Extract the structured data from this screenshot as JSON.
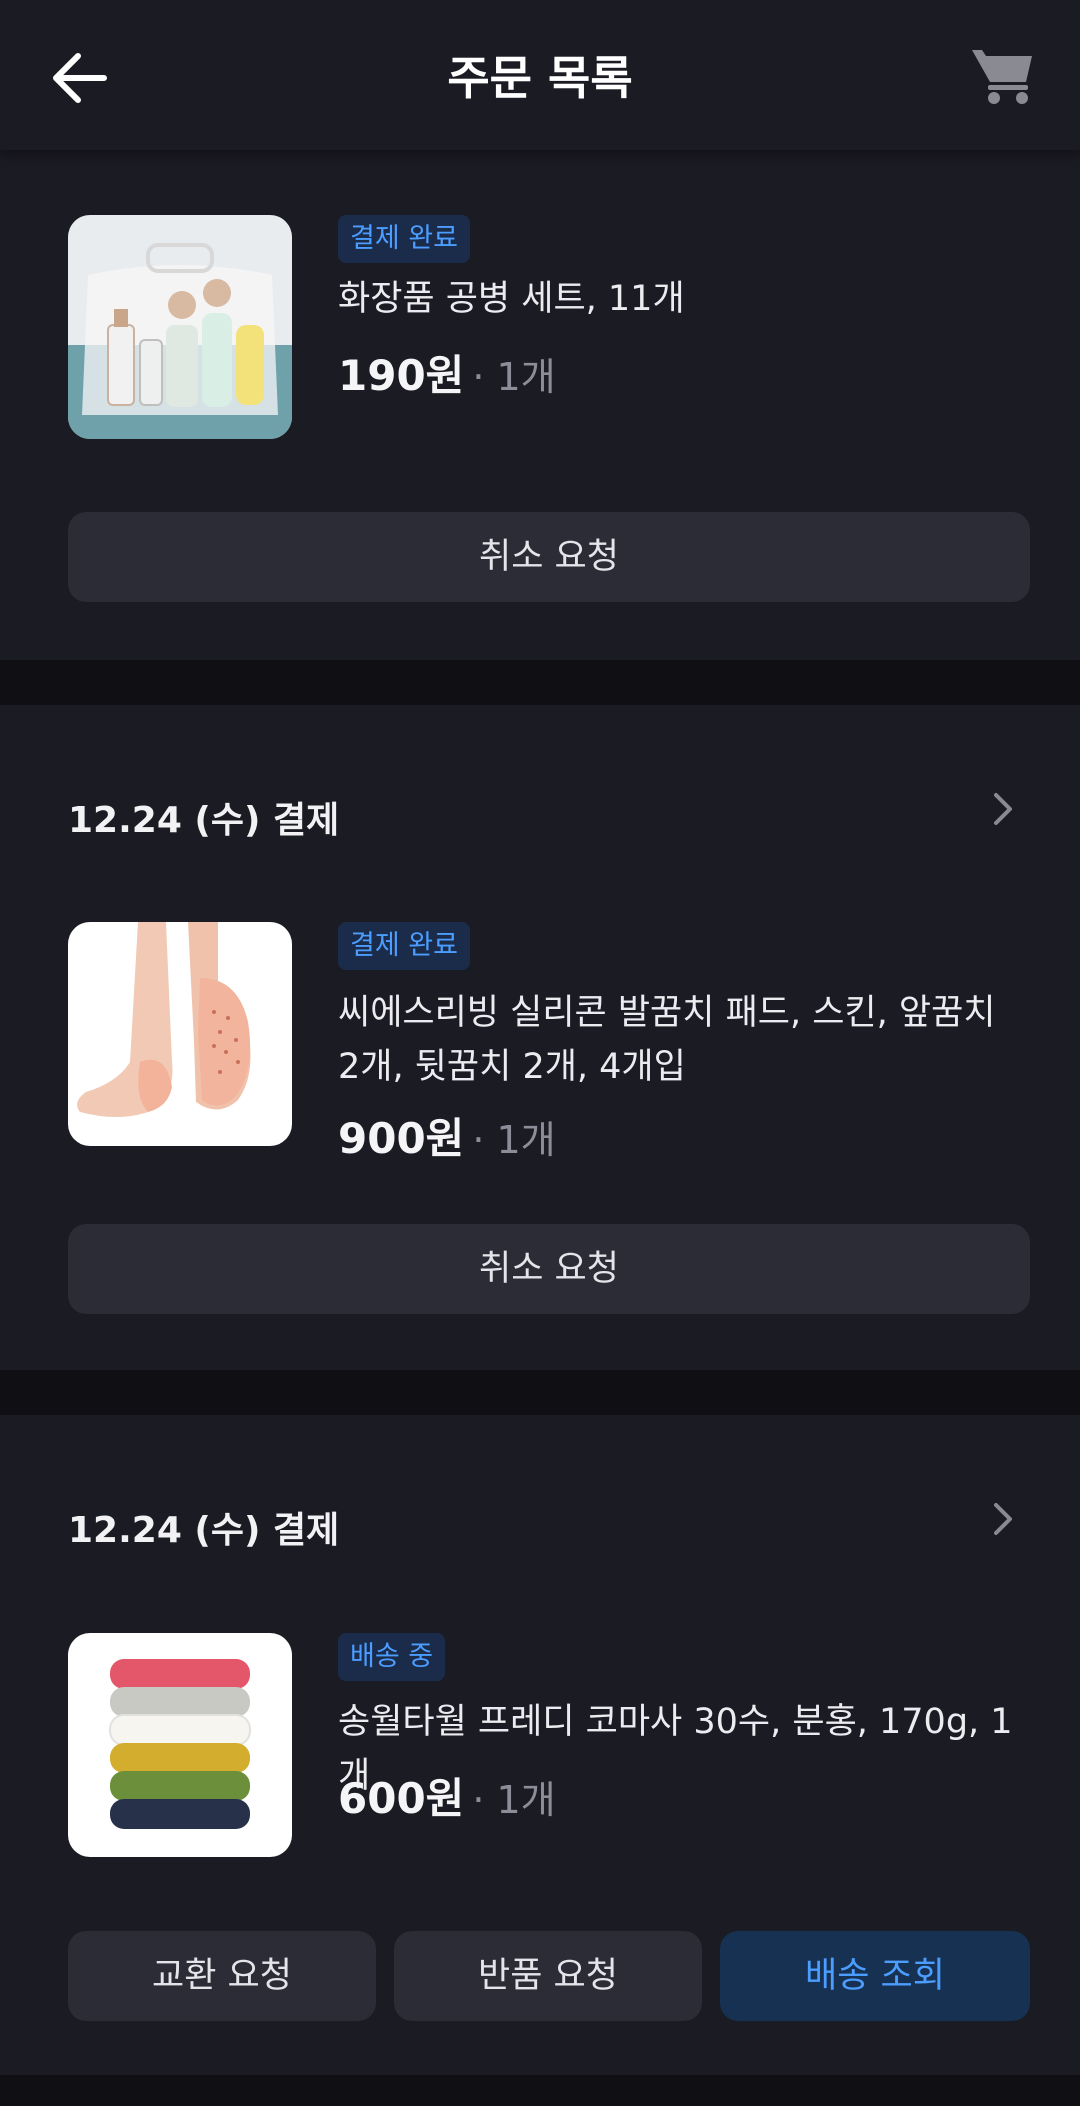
{
  "header": {
    "title": "주문 목록",
    "back_icon": "arrow-left-icon",
    "cart_icon": "cart-icon"
  },
  "orders": [
    {
      "status": "결제 완료",
      "name": "화장품 공병 세트, 11개",
      "price": "190원",
      "qty": "· 1개",
      "buttons": [
        "취소 요청"
      ]
    },
    {
      "date": "12.24 (수) 결제",
      "status": "결제 완료",
      "name": "씨에스리빙 실리콘 발꿈치 패드, 스킨, 앞꿈치 2개, 뒷꿈치 2개, 4개입",
      "price": "900원",
      "qty": "· 1개",
      "buttons": [
        "취소 요청"
      ]
    },
    {
      "date": "12.24 (수) 결제",
      "status": "배송 중",
      "name": "송월타월 프레디 코마사 30수, 분홍, 170g, 1개",
      "price": "600원",
      "qty": "· 1개",
      "buttons": [
        "교환 요청",
        "반품 요청",
        "배송 조회"
      ]
    }
  ],
  "colors": {
    "accent": "#4b9dff",
    "badge_bg": "#1b2c4a",
    "card_bg": "#1b1b23",
    "page_bg": "#0f0f14",
    "button_bg": "#2b2c35"
  }
}
